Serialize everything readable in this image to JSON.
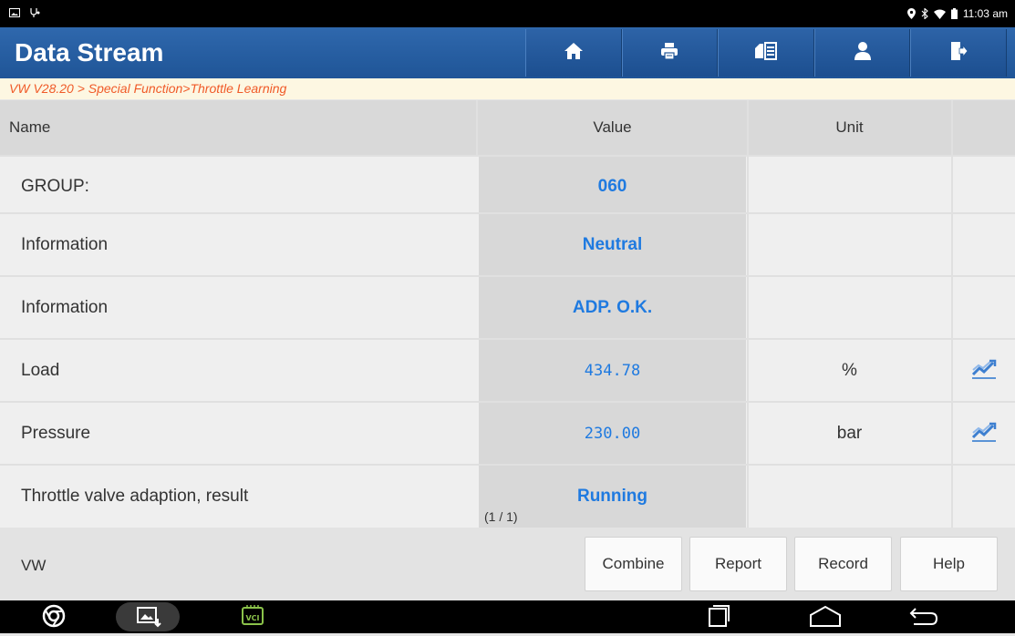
{
  "status": {
    "time": "11:03 am",
    "left_icons": [
      "gallery-icon",
      "usb-debug-icon"
    ],
    "right_icons": [
      "location-icon",
      "bluetooth-icon",
      "wifi-icon",
      "battery-icon"
    ]
  },
  "header": {
    "title": "Data Stream",
    "toolbar": [
      "home-icon",
      "print-icon",
      "screenshot-icon",
      "user-icon",
      "exit-icon"
    ]
  },
  "breadcrumb": "VW V28.20 > Special Function>Throttle Learning",
  "table": {
    "columns": {
      "name": "Name",
      "value": "Value",
      "unit": "Unit"
    },
    "rows": [
      {
        "name": "GROUP:",
        "value": "060",
        "unit": "",
        "graph": false
      },
      {
        "name": "Information",
        "value": "Neutral",
        "unit": "",
        "graph": false
      },
      {
        "name": "Information",
        "value": "ADP. O.K.",
        "unit": "",
        "graph": false
      },
      {
        "name": "Load",
        "value": "434.78",
        "unit": "%",
        "graph": true
      },
      {
        "name": "Pressure",
        "value": "230.00",
        "unit": "bar",
        "graph": true
      },
      {
        "name": "Throttle valve adaption, result",
        "value": "Running",
        "unit": "",
        "graph": false
      }
    ],
    "pager": "(1 / 1)"
  },
  "footer": {
    "label": "VW",
    "buttons": {
      "combine": "Combine",
      "report": "Report",
      "record": "Record",
      "help": "Help"
    }
  },
  "navbar": {
    "vci_label": "VCI",
    "icons": [
      "chrome-icon",
      "gallery-download-icon",
      "vci-icon",
      "recents-icon",
      "home-nav-icon",
      "back-icon"
    ]
  },
  "colors": {
    "header": "#1f5597",
    "value_text": "#1f7ae0",
    "breadcrumb_text": "#f05a28"
  }
}
